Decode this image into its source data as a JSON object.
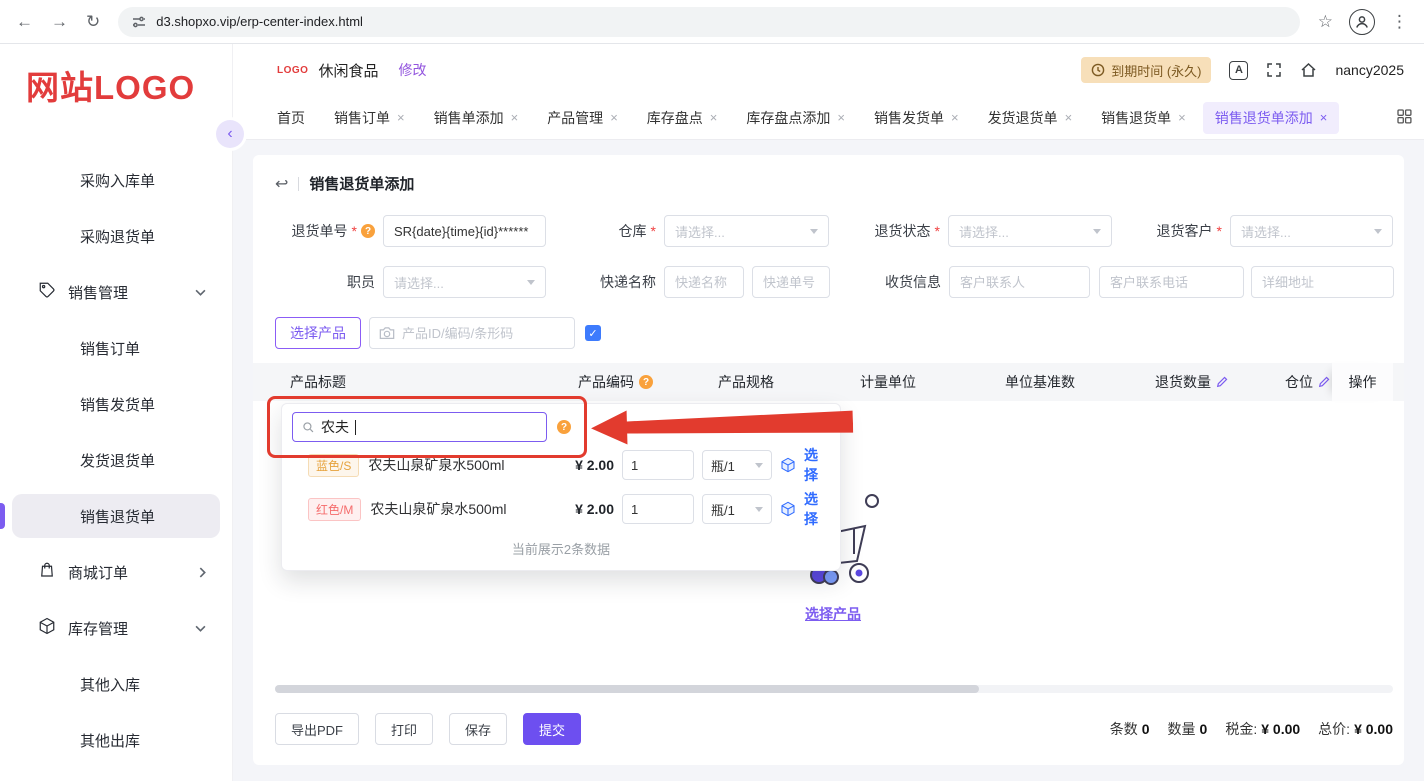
{
  "icons": {
    "back": "←",
    "forward": "→",
    "refresh": "↻",
    "star": "☆",
    "menu": "⋮",
    "undo": "↩",
    "check": "✓",
    "help": "?",
    "close": "×",
    "collapse": "‹",
    "required": "*",
    "translate": "A"
  },
  "colors": {
    "accent": "#7c5cf0",
    "accent_dark": "#6d4ff0",
    "warning": "#f9a13c",
    "danger": "#e23b2e",
    "link_blue": "#2f6bff",
    "logo_red": "#e23c3c"
  },
  "browser": {
    "url": "d3.shopxo.vip/erp-center-index.html"
  },
  "sidebar": {
    "logo_primary": "网站",
    "logo_secondary": "LOGO",
    "items": [
      {
        "label": "采购入库单"
      },
      {
        "label": "采购退货单"
      },
      {
        "label": "销售管理"
      },
      {
        "label": "销售订单"
      },
      {
        "label": "销售发货单"
      },
      {
        "label": "发货退货单"
      },
      {
        "label": "销售退货单"
      },
      {
        "label": "商城订单"
      },
      {
        "label": "库存管理"
      },
      {
        "label": "其他入库"
      },
      {
        "label": "其他出库"
      }
    ]
  },
  "topbar": {
    "logo_badge": "LOGO",
    "store_name": "休闲食品",
    "modify": "修改",
    "expiry": "到期时间 (永久)",
    "username": "nancy2025"
  },
  "tabs": [
    {
      "label": "首页"
    },
    {
      "label": "销售订单"
    },
    {
      "label": "销售单添加"
    },
    {
      "label": "产品管理"
    },
    {
      "label": "库存盘点"
    },
    {
      "label": "库存盘点添加"
    },
    {
      "label": "销售发货单"
    },
    {
      "label": "发货退货单"
    },
    {
      "label": "销售退货单"
    },
    {
      "label": "销售退货单添加"
    }
  ],
  "page": {
    "title": "销售退货单添加",
    "form": {
      "return_no": {
        "label": "退货单号",
        "value": "SR{date}{time}{id}******"
      },
      "warehouse": {
        "label": "仓库",
        "placeholder": "请选择..."
      },
      "return_status": {
        "label": "退货状态",
        "placeholder": "请选择..."
      },
      "return_customer": {
        "label": "退货客户",
        "placeholder": "请选择..."
      },
      "staff": {
        "label": "职员",
        "placeholder": "请选择..."
      },
      "express": {
        "label": "快递名称",
        "name_placeholder": "快递名称",
        "no_placeholder": "快递单号"
      },
      "receiving": {
        "label": "收货信息",
        "contact_placeholder": "客户联系人",
        "phone_placeholder": "客户联系电话",
        "address_placeholder": "详细地址"
      }
    },
    "toolbar": {
      "select_product": "选择产品",
      "search_placeholder": "产品ID/编码/条形码"
    },
    "table": {
      "headers": [
        "产品标题",
        "产品编码",
        "产品规格",
        "计量单位",
        "单位基准数",
        "退货数量",
        "仓位",
        "操作"
      ]
    },
    "dropdown": {
      "search_value": "农夫",
      "rows": [
        {
          "spec": "蓝色/S",
          "title": "农夫山泉矿泉水500ml",
          "price": "¥ 2.00",
          "qty": "1",
          "unit": "瓶/1",
          "action": "选择"
        },
        {
          "spec": "红色/M",
          "title": "农夫山泉矿泉水500ml",
          "price": "¥ 2.00",
          "qty": "1",
          "unit": "瓶/1",
          "action": "选择"
        }
      ],
      "footer": "当前展示2条数据"
    },
    "empty": {
      "link": "选择产品"
    },
    "footer": {
      "export_pdf": "导出PDF",
      "print": "打印",
      "save": "保存",
      "submit": "提交",
      "stats": [
        {
          "label": "条数",
          "value": "0"
        },
        {
          "label": "数量",
          "value": "0"
        },
        {
          "label": "税金:",
          "value": "¥ 0.00"
        },
        {
          "label": "总价:",
          "value": "¥ 0.00"
        }
      ]
    }
  }
}
